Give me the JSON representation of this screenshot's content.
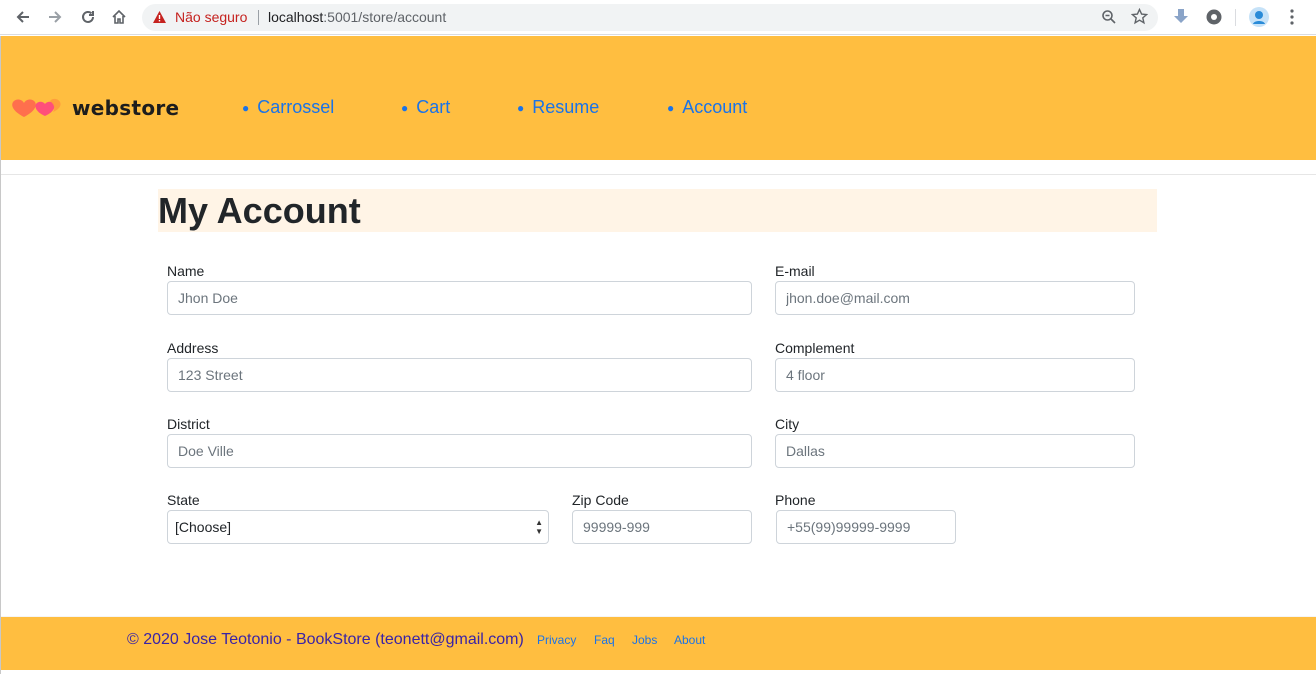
{
  "browser": {
    "security_text": "Não seguro",
    "url_host": "localhost",
    "url_rest": ":5001/store/account"
  },
  "header": {
    "logo_text": "webstore",
    "nav": [
      "Carrossel",
      "Cart",
      "Resume",
      "Account"
    ]
  },
  "main": {
    "title": "My Account",
    "fields": {
      "name": {
        "label": "Name",
        "placeholder": "Jhon Doe"
      },
      "email": {
        "label": "E-mail",
        "placeholder": "jhon.doe@mail.com"
      },
      "address": {
        "label": "Address",
        "placeholder": "123 Street"
      },
      "complement": {
        "label": "Complement",
        "placeholder": "4 floor"
      },
      "district": {
        "label": "District",
        "placeholder": "Doe Ville"
      },
      "city": {
        "label": "City",
        "placeholder": "Dallas"
      },
      "state": {
        "label": "State",
        "value": "[Choose]"
      },
      "zip": {
        "label": "Zip Code",
        "placeholder": "99999-999"
      },
      "phone": {
        "label": "Phone",
        "placeholder": "+55(99)99999-9999"
      }
    }
  },
  "footer": {
    "copyright": "© 2020 Jose Teotonio - BookStore (teonett@gmail.com)",
    "links": [
      "Privacy",
      "Faq",
      "Jobs",
      "About"
    ]
  },
  "colors": {
    "brand": "#ffbe40",
    "link": "#1a73e8",
    "title_bg": "#fff4e6",
    "footer_text": "#3a23a6"
  },
  "icons": [
    "back-icon",
    "forward-icon",
    "reload-icon",
    "home-icon",
    "warning-icon",
    "zoom-icon",
    "star-icon",
    "download-icon",
    "extension-icon",
    "profile-icon",
    "menu-icon"
  ]
}
